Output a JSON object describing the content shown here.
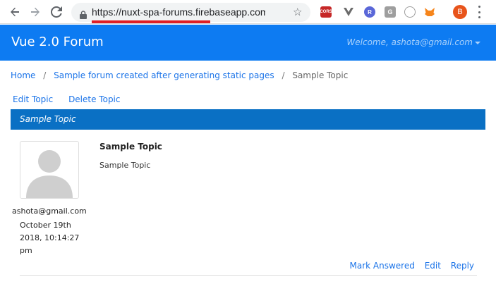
{
  "browser": {
    "url": "https://nuxt-spa-forums.firebaseapp.com/pos…",
    "profile_initial": "B",
    "extension_cors_label": "CORS",
    "extension_r_label": "R",
    "extension_g_label": "G",
    "icons": [
      "back-icon",
      "forward-icon",
      "reload-icon",
      "lock-icon",
      "star-icon",
      "menu-icon"
    ]
  },
  "navbar": {
    "brand": "Vue 2.0 Forum",
    "welcome": "Welcome, ashota@gmail.com"
  },
  "breadcrumb": {
    "home": "Home",
    "forum": "Sample forum created after generating static pages",
    "current": "Sample Topic",
    "separator": "/"
  },
  "topic_actions": {
    "edit": "Edit Topic",
    "delete": "Delete Topic"
  },
  "topic": {
    "bar_title": "Sample Topic"
  },
  "post": {
    "author": "ashota@gmail.com",
    "date": "October 19th 2018, 10:14:27 pm",
    "title": "Sample Topic",
    "body": "Sample Topic",
    "actions": {
      "mark_answered": "Mark Answered",
      "edit": "Edit",
      "reply": "Reply"
    }
  },
  "colors": {
    "navbar": "#0d7bf2",
    "topic_bar": "#0a70c4",
    "link": "#1a73e8",
    "url_underline": "#e01f26"
  }
}
